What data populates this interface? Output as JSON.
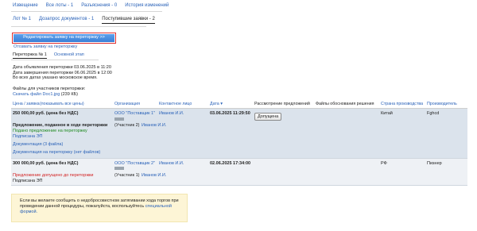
{
  "topnav": [
    "Извещение",
    "Все лоты - 1",
    "Разъяснения - 0",
    "История изменений"
  ],
  "subnav": [
    "Лот № 1",
    "Дозапрос документов - 1",
    "Поступившие заявки - 2"
  ],
  "edit_button": "Редактировать заявку на переторжку >>",
  "revoke_link": "Отозвать заявку на переторжку",
  "stage_tabs": [
    "Переторжка № 1",
    "Основной этап"
  ],
  "info": {
    "announced": "Дата объявления переторжки 03.06.2025 в 11:20",
    "finished": "Дата завершения переторжки 06.06.2025 в 12:00",
    "tz": "Во всех датах указано московское время."
  },
  "files": {
    "label": "Файлы для участников переторжки:",
    "link": "Скачать файл Doc1.jpg",
    "size": "(239 КБ)"
  },
  "table": {
    "headers": {
      "price": "Цена / заявка",
      "show_all": "(показывать все цены)",
      "org": "Организация",
      "contact": "Контактное лицо",
      "date": "Дата ▾",
      "consider": "Рассмотрение предложений",
      "files": "Файлы обоснования решения",
      "country": "Страна производства",
      "maker": "Производитель"
    },
    "rows": [
      {
        "price": "250 000,00 руб. (цена без НДС)",
        "org": "ООО \"Поставщик 1\"",
        "contact": "Иванов И.И.",
        "date": "03.06.2025 11:29:50",
        "action": "Допущена",
        "status": "Предложение, поданное в ходе переторжки",
        "participant": "(Участник 2)",
        "participant_contact": "Иванов И.И.",
        "sub_status": "Подано предложение на переторжку",
        "signed": "Подписана ЭП",
        "docs": "Документация (3 файла)",
        "docs2": "Документация на переторжку (нет файлов)",
        "country": "Китай",
        "maker": "Fghcd"
      },
      {
        "price": "300 000,00 руб. (цена без НДС)",
        "org": "ООО \"Поставщик 2\"",
        "contact": "Иванов И.И.",
        "date": "02.06.2025 17:34:00",
        "status": "Предложение допущено до переторжки",
        "participant": "(Участник 1)",
        "participant_contact": "Иванов И.И.",
        "signed": "Подписана ЭП",
        "country": "РФ",
        "maker": "Пизнер"
      }
    ]
  },
  "notice": {
    "text": "Если вы желаете сообщить о недобросовестном затягивании хода торгов при проведении данной процедуры, пожалуйста, воспользуйтесь",
    "link": "специальной формой."
  }
}
